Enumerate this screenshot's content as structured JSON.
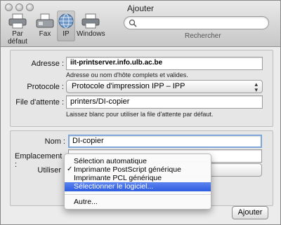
{
  "window": {
    "title": "Ajouter"
  },
  "toolbar": {
    "items": [
      {
        "label": "Par défaut",
        "icon": "default-printer-icon"
      },
      {
        "label": "Fax",
        "icon": "fax-icon"
      },
      {
        "label": "IP",
        "icon": "ip-globe-icon",
        "active": true
      },
      {
        "label": "Windows",
        "icon": "windows-printer-icon"
      }
    ],
    "search": {
      "placeholder": "",
      "value": "",
      "label": "Rechercher"
    }
  },
  "form": {
    "address": {
      "label": "Adresse :",
      "value": "iit-printserver.info.ulb.ac.be",
      "hint": "Adresse ou nom d'hôte complets et valides."
    },
    "protocol": {
      "label": "Protocole :",
      "value": "Protocole d'impression IPP – IPP"
    },
    "queue": {
      "label": "File d'attente :",
      "value": "printers/DI-copier",
      "hint": "Laissez blanc pour utiliser la file d'attente par défaut."
    },
    "name": {
      "label": "Nom :",
      "value": "DI-copier"
    },
    "location": {
      "label": "Emplacement :"
    },
    "use": {
      "label": "Utiliser"
    }
  },
  "menu": {
    "items": [
      {
        "label": "Sélection automatique",
        "checked": false,
        "selected": false
      },
      {
        "label": "Imprimante PostScript générique",
        "checked": true,
        "selected": false
      },
      {
        "label": "Imprimante PCL générique",
        "checked": false,
        "selected": false
      },
      {
        "label": "Sélectionner le logiciel...",
        "checked": false,
        "selected": true
      },
      {
        "label": "Autre...",
        "checked": false,
        "selected": false
      }
    ],
    "check_mark": "✓"
  },
  "buttons": {
    "add": "Ajouter"
  },
  "colors": {
    "highlight": "#2e5ce0",
    "focus_ring": "#7fa6d9"
  }
}
